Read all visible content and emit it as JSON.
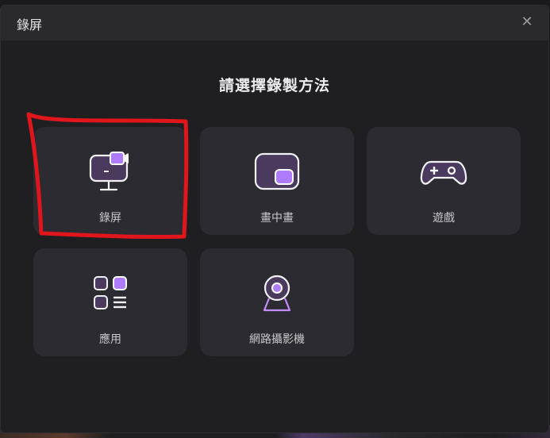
{
  "dialog": {
    "title": "錄屏",
    "close_icon": "close-icon",
    "heading": "請選擇錄製方法"
  },
  "options": [
    {
      "label": "錄屏",
      "icon": "monitor-camera-icon"
    },
    {
      "label": "畫中畫",
      "icon": "picture-in-picture-icon"
    },
    {
      "label": "遊戲",
      "icon": "gamepad-icon"
    },
    {
      "label": "應用",
      "icon": "apps-grid-icon"
    },
    {
      "label": "網路攝影機",
      "icon": "webcam-icon"
    }
  ],
  "colors": {
    "accent": "#9b5cf6",
    "card": "#2c2b31",
    "annotation": "#e0161c"
  }
}
